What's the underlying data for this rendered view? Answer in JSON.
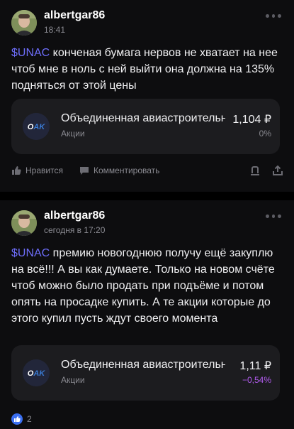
{
  "posts": [
    {
      "username": "albertgar86",
      "time": "18:41",
      "ticker": "$UNAC",
      "text": " конченая бумага нервов не хватает на нее чтоб мне в ноль с ней выйти она должна на 135% подняться от этой цены",
      "stock": {
        "name": "Объединенная авиастроительная корпорация",
        "type": "Акции",
        "price": "1,104 ₽",
        "change": "0%",
        "change_color": "#8a8a91"
      },
      "actions": {
        "like_label": "Нравится",
        "comment_label": "Комментировать"
      }
    },
    {
      "username": "albertgar86",
      "time": "сегодня в 17:20",
      "ticker": "$UNAC",
      "text": " премию новогоднюю получу ещё закуплю на всё!!! А вы как думаете. Только на новом счёте чтоб можно было продать при подъёме и потом опять на просадке купить. А те акции которые до этого купил пусть ждут своего момента",
      "stock": {
        "name": "Объединенная авиастроительная корпорация",
        "type": "Акции",
        "price": "1,11 ₽",
        "change": "−0,54%",
        "change_color": "#b35cf0"
      },
      "reactions": {
        "count": "2"
      }
    }
  ],
  "colors": {
    "accent": "#6d6df9",
    "card": "#1c1c1f",
    "muted": "#8a8a91"
  },
  "icons": [
    "more-icon",
    "like-icon",
    "comment-icon",
    "bookmark-icon",
    "share-icon",
    "thumbs-up-icon"
  ]
}
